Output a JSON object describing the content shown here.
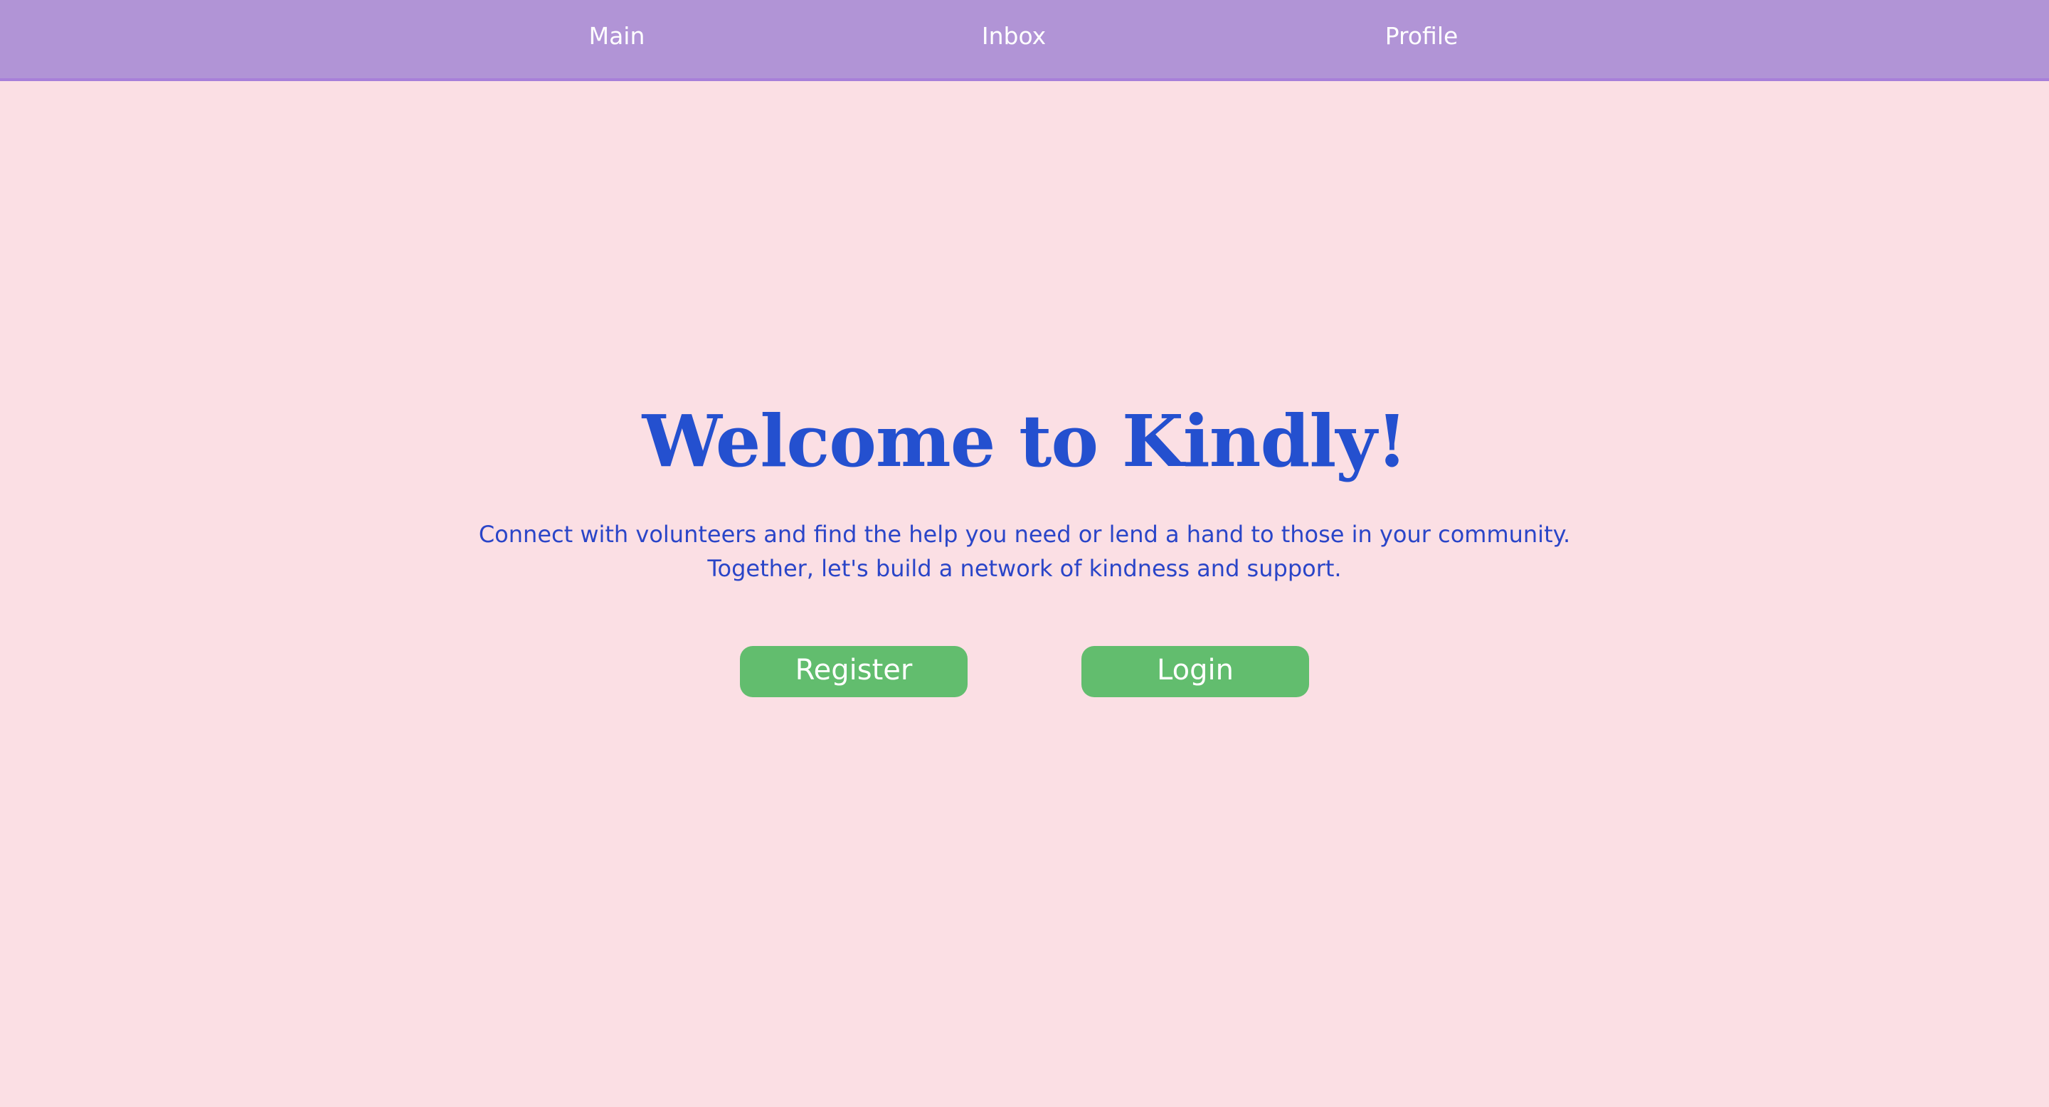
{
  "nav": {
    "items": [
      {
        "label": "Main"
      },
      {
        "label": "Inbox"
      },
      {
        "label": "Profile"
      }
    ]
  },
  "hero": {
    "title": "Welcome to Kindly!",
    "subtitle_line1": "Connect with volunteers and find the help you need or lend a hand to those in your community.",
    "subtitle_line2": "Together, let's build a network of kindness and support."
  },
  "actions": {
    "register_label": "Register",
    "login_label": "Login"
  },
  "colors": {
    "background": "#fbdfe4",
    "navbar": "#b194d6",
    "heading": "#2450cf",
    "button": "#62bd6e"
  }
}
